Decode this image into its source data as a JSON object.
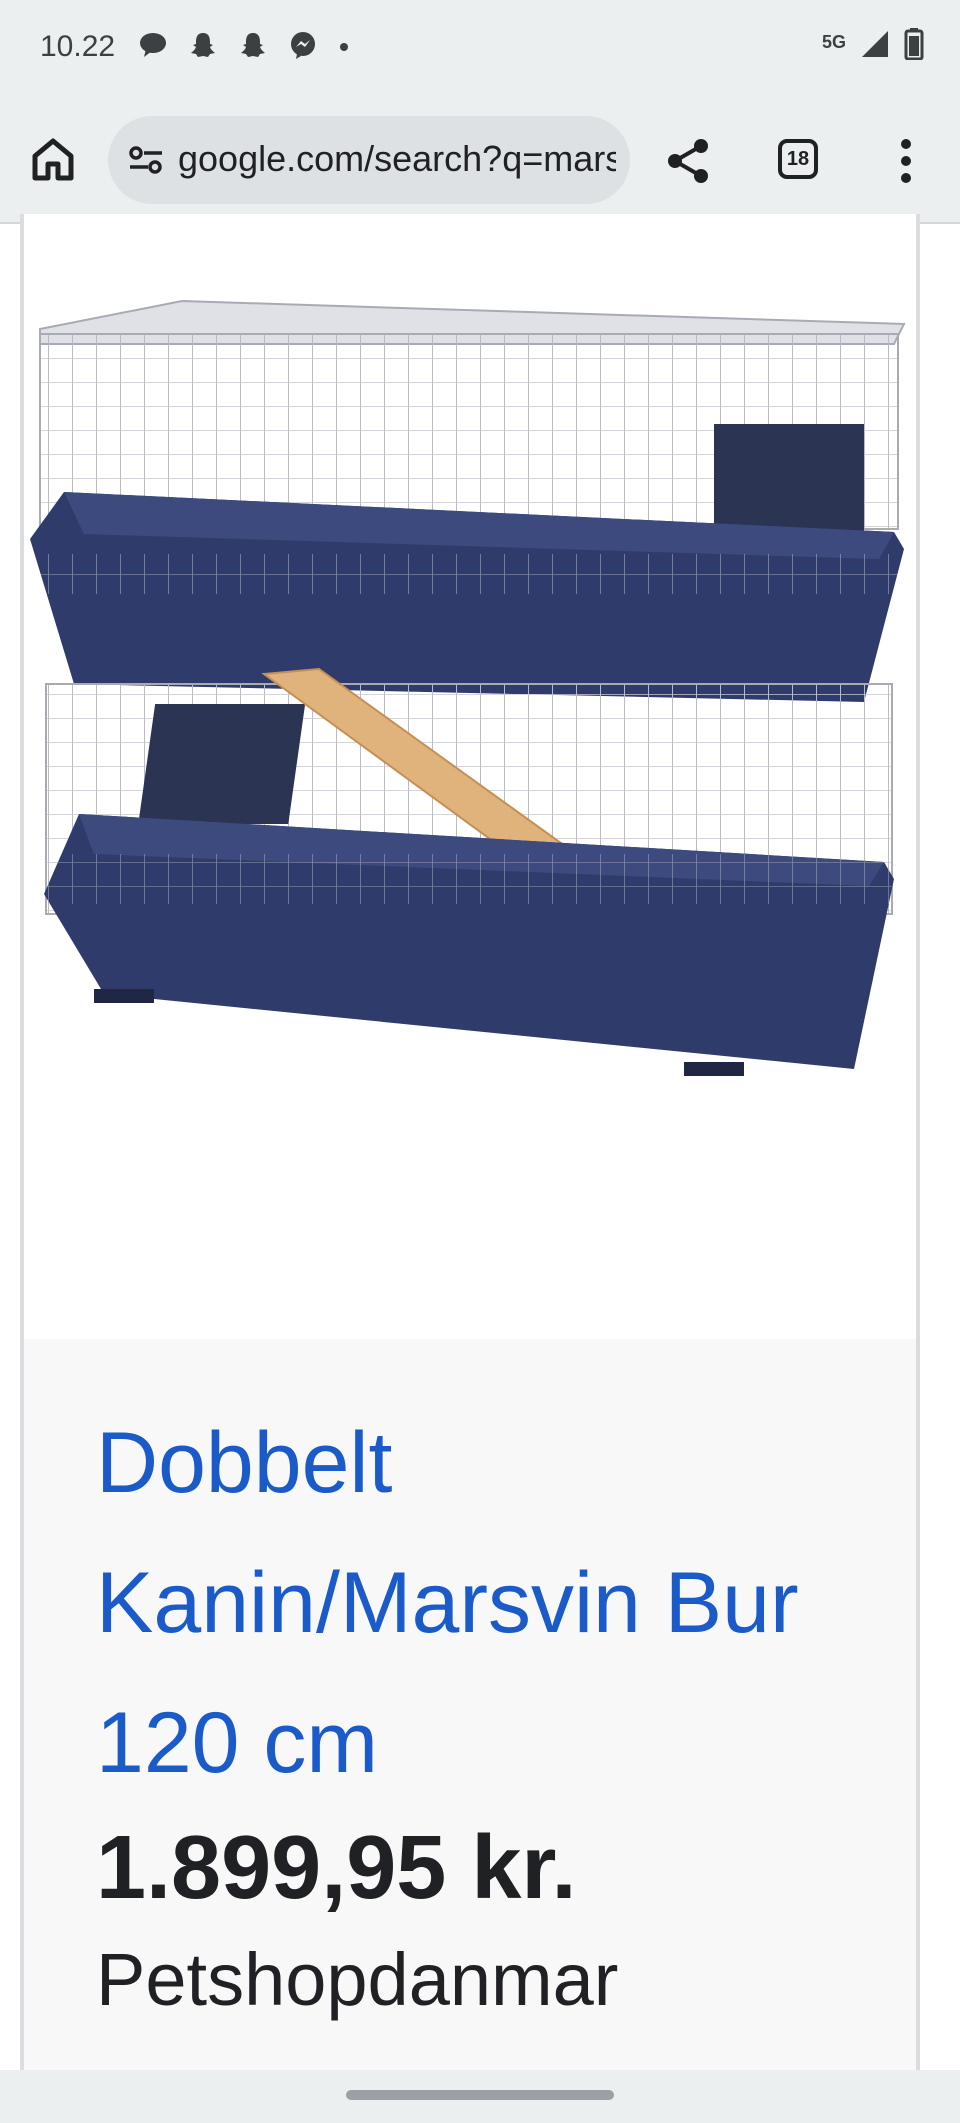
{
  "status_bar": {
    "time": "10.22",
    "notification_icons": [
      "chat-bubble-icon",
      "snapchat-icon",
      "snapchat-icon",
      "messenger-icon",
      "dot-icon"
    ],
    "network": "5G",
    "signal_icon": "signal-icon",
    "battery_icon": "battery-icon"
  },
  "toolbar": {
    "home_icon": "home-icon",
    "site_info_icon": "tune-icon",
    "url": "google.com/search?q=marsvin",
    "share_icon": "share-icon",
    "tab_count": "18",
    "menu_icon": "more-vert-icon"
  },
  "product": {
    "image_subject": "two-tier-cage-image",
    "title": "Dobbelt Kanin/Marsvin Bur 120 cm",
    "price": "1.899,95 kr.",
    "merchant": "Petshopdanmar"
  },
  "colors": {
    "chrome_bg": "#eceff0",
    "link_blue": "#1a5bc9",
    "cage_base": "#2f3c6b",
    "ramp": "#e0b27c"
  }
}
